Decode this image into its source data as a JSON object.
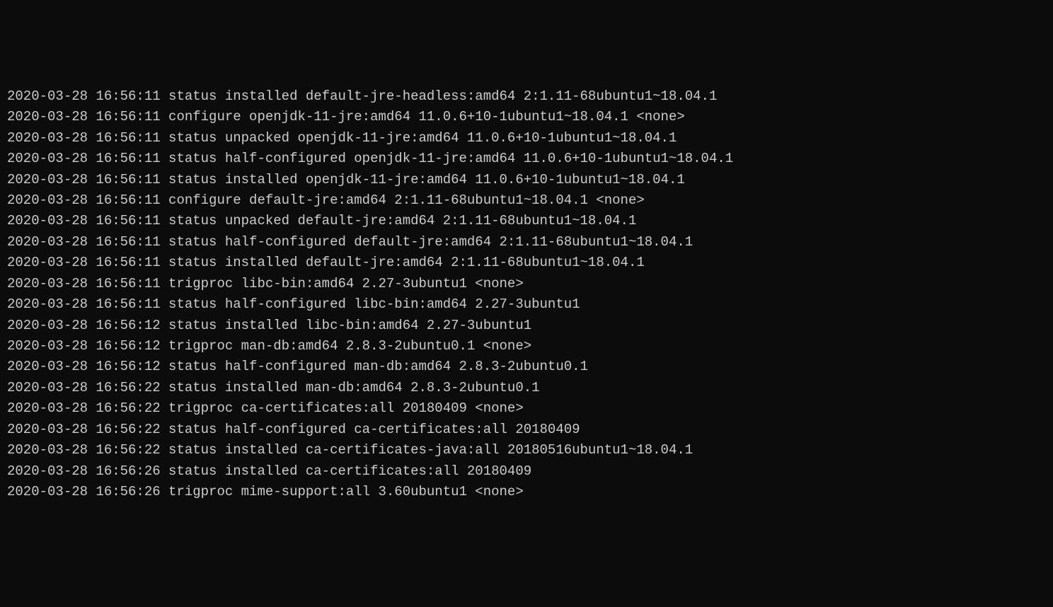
{
  "log": {
    "lines": [
      "2020-03-28 16:56:11 status installed default-jre-headless:amd64 2:1.11-68ubuntu1~18.04.1",
      "2020-03-28 16:56:11 configure openjdk-11-jre:amd64 11.0.6+10-1ubuntu1~18.04.1 <none>",
      "2020-03-28 16:56:11 status unpacked openjdk-11-jre:amd64 11.0.6+10-1ubuntu1~18.04.1",
      "2020-03-28 16:56:11 status half-configured openjdk-11-jre:amd64 11.0.6+10-1ubuntu1~18.04.1",
      "2020-03-28 16:56:11 status installed openjdk-11-jre:amd64 11.0.6+10-1ubuntu1~18.04.1",
      "2020-03-28 16:56:11 configure default-jre:amd64 2:1.11-68ubuntu1~18.04.1 <none>",
      "2020-03-28 16:56:11 status unpacked default-jre:amd64 2:1.11-68ubuntu1~18.04.1",
      "2020-03-28 16:56:11 status half-configured default-jre:amd64 2:1.11-68ubuntu1~18.04.1",
      "2020-03-28 16:56:11 status installed default-jre:amd64 2:1.11-68ubuntu1~18.04.1",
      "2020-03-28 16:56:11 trigproc libc-bin:amd64 2.27-3ubuntu1 <none>",
      "2020-03-28 16:56:11 status half-configured libc-bin:amd64 2.27-3ubuntu1",
      "2020-03-28 16:56:12 status installed libc-bin:amd64 2.27-3ubuntu1",
      "2020-03-28 16:56:12 trigproc man-db:amd64 2.8.3-2ubuntu0.1 <none>",
      "2020-03-28 16:56:12 status half-configured man-db:amd64 2.8.3-2ubuntu0.1",
      "2020-03-28 16:56:22 status installed man-db:amd64 2.8.3-2ubuntu0.1",
      "2020-03-28 16:56:22 trigproc ca-certificates:all 20180409 <none>",
      "2020-03-28 16:56:22 status half-configured ca-certificates:all 20180409",
      "2020-03-28 16:56:22 status installed ca-certificates-java:all 20180516ubuntu1~18.04.1",
      "2020-03-28 16:56:26 status installed ca-certificates:all 20180409",
      "2020-03-28 16:56:26 trigproc mime-support:all 3.60ubuntu1 <none>"
    ]
  }
}
